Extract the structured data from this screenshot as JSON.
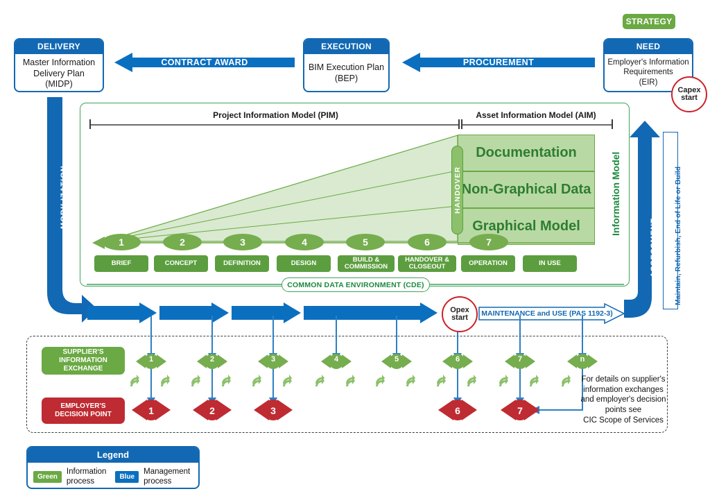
{
  "top_row": {
    "strategy_label": "STRATEGY",
    "boxes": [
      {
        "header": "DELIVERY",
        "body": "Master Information\nDelivery Plan\n(MIDP)"
      },
      {
        "header": "EXECUTION",
        "body": "BIM Execution Plan\n(BEP)"
      },
      {
        "header": "NEED",
        "body": "Employer's Information\nRequirements\n(EIR)"
      }
    ],
    "arrows": [
      {
        "label": "CONTRACT AWARD"
      },
      {
        "label": "PROCUREMENT"
      }
    ]
  },
  "markers": {
    "capex": "Capex\nstart",
    "opex": "Opex\nstart"
  },
  "side_labels": {
    "mobilization": "MOBILIZATION",
    "assessment": "ASSESSMENT",
    "maintain": "Maintain, Refurbish, End of Life or Build",
    "information_model": "Information Model"
  },
  "panel": {
    "pim_title": "Project Information Model (PIM)",
    "aim_title": "Asset Information Model (AIM)",
    "handover": "HANDOVER",
    "cde": "COMMON DATA ENVIRONMENT (CDE)",
    "model_bars": [
      "Documentation",
      "Non-Graphical Data",
      "Graphical Model"
    ],
    "stages": [
      {
        "num": "1",
        "label": "BRIEF"
      },
      {
        "num": "2",
        "label": "CONCEPT"
      },
      {
        "num": "3",
        "label": "DEFINITION"
      },
      {
        "num": "4",
        "label": "DESIGN"
      },
      {
        "num": "5",
        "label": "BUILD &\nCOMMISSION"
      },
      {
        "num": "6",
        "label": "HANDOVER &\nCLOSEOUT"
      },
      {
        "num": "7",
        "label": "OPERATION"
      },
      {
        "num": "",
        "label": "IN USE"
      }
    ]
  },
  "maintenance": {
    "label": "MAINTENANCE and USE (PAS 1192-3)"
  },
  "exchange": {
    "supplier_label": "SUPPLIER'S\nINFORMATION\nEXCHANGE",
    "employer_label": "EMPLOYER'S\nDECISION POINT",
    "supplier_points": [
      "1",
      "2",
      "3",
      "4",
      "5",
      "6",
      "7",
      "n"
    ],
    "employer_points": [
      "1",
      "2",
      "3",
      "",
      "",
      "6",
      "7",
      ""
    ],
    "note": "For details on supplier's\ninformation exchanges\nand employer's decision\npoints see\nCIC Scope of Services"
  },
  "legend": {
    "title": "Legend",
    "items": [
      {
        "swatch": "Green",
        "text": "Information\nprocess"
      },
      {
        "swatch": "Blue",
        "text": "Management\nprocess"
      }
    ]
  },
  "colors": {
    "blue": "#1268b3",
    "blue_arrow": "#0b6fc0",
    "green": "#6aa943",
    "green_dark": "#2e7d32",
    "green_light": "#b9d9a4",
    "red": "#bf2b32",
    "red_circle": "#cc2027"
  }
}
